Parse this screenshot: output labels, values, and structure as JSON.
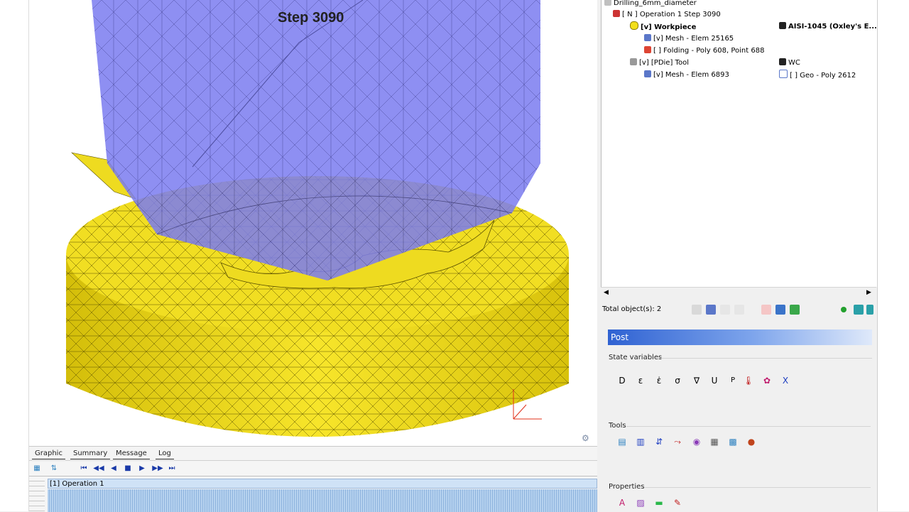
{
  "viewport": {
    "step_label": "Step 3090"
  },
  "tabs": [
    "Graphic",
    "Summary",
    "Message",
    "Log"
  ],
  "timeline": {
    "operation_label": "[1] Operation 1"
  },
  "tree": {
    "root": "Drilling_6mm_diameter",
    "operation": "[ N ] Operation 1  Step 3090",
    "workpiece": "[v] Workpiece",
    "workpiece_mesh": "[v] Mesh - Elem 25165",
    "folding": "[ ] Folding - Poly 608, Point 688",
    "tool": "[v] [PDie] Tool",
    "tool_mesh": "[v] Mesh - Elem 6893",
    "workpiece_material": "AISI-1045 (Oxley's E...",
    "tool_material": "WC",
    "tool_geo": "[ ] Geo - Poly 2612"
  },
  "status": {
    "total_objects": "Total object(s): 2"
  },
  "post": {
    "header": "Post",
    "state_variables_label": "State variables",
    "tools_label": "Tools",
    "properties_label": "Properties",
    "state_icons": [
      "D",
      "ε",
      "ε̇",
      "σ",
      "∇",
      "U",
      "P",
      "thermo",
      "dmg",
      "X"
    ],
    "tool_icons": [
      "doc",
      "bar",
      "flow",
      "tension",
      "sphere",
      "table",
      "grid",
      "ball"
    ]
  },
  "colors": {
    "workpiece": "#f2df1a",
    "tool": "#7b7cf0",
    "post_header": "#2f62d2"
  }
}
